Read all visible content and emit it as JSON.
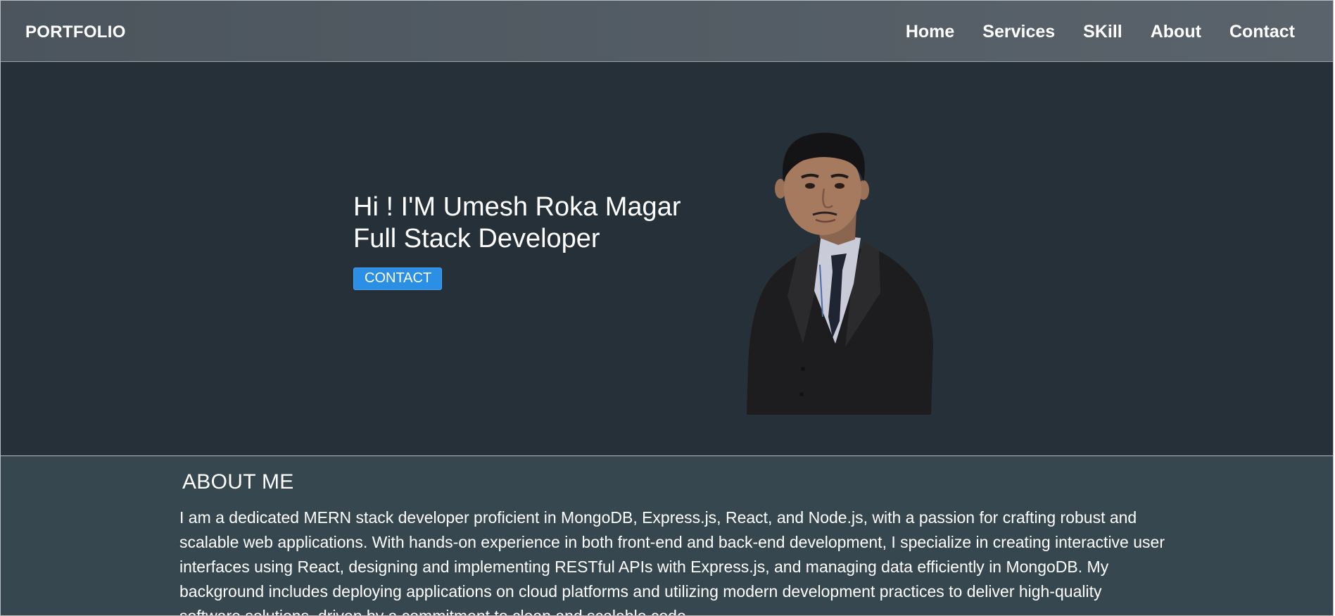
{
  "navbar": {
    "brand": "PORTFOLIO",
    "links": [
      "Home",
      "Services",
      "SKill",
      "About",
      "Contact"
    ]
  },
  "hero": {
    "greeting": "Hi ! I'M Umesh Roka Magar",
    "role": "Full Stack Developer",
    "button_label": "CONTACT",
    "portrait_alt": "profile-photo"
  },
  "about": {
    "title": "ABOUT ME",
    "text": "I am a dedicated MERN stack developer proficient in MongoDB, Express.js, React, and Node.js, with a passion for crafting robust and scalable web applications. With hands-on experience in both front-end and back-end development, I specialize in creating interactive user interfaces using React, designing and implementing RESTful APIs with Express.js, and managing data efficiently in MongoDB. My background includes deploying applications on cloud platforms and utilizing modern development practices to deliver high-quality software solutions, driven by a commitment to clean and scalable code."
  },
  "colors": {
    "navbar_bg": "#525b63",
    "hero_bg": "#263038",
    "about_bg": "#37474f",
    "button_bg": "#2b8fe6",
    "text": "#ffffff"
  }
}
